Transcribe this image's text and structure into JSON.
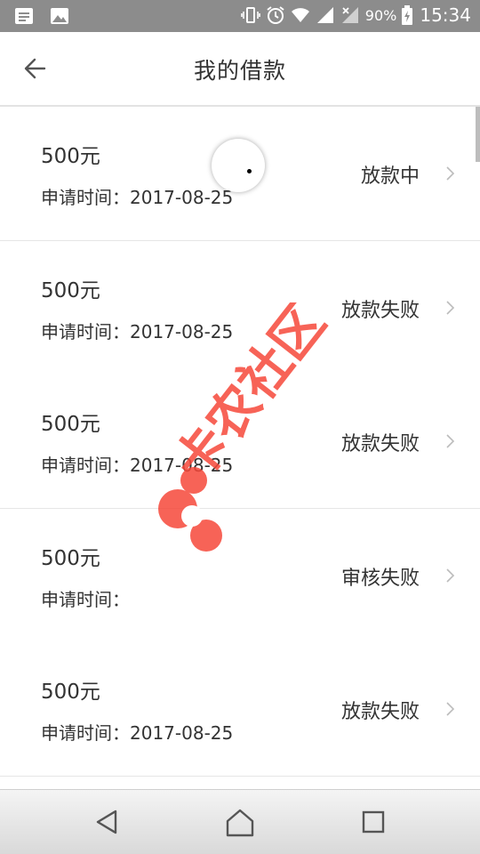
{
  "status_bar": {
    "battery": "90%",
    "time": "15:34",
    "icons": [
      "notification-icon",
      "image-icon",
      "vibrate-icon",
      "alarm-icon",
      "wifi-icon",
      "signal-icon",
      "signal-icon",
      "battery-icon"
    ]
  },
  "header": {
    "title": "我的借款"
  },
  "loans": [
    {
      "amount": "500元",
      "date_label": "申请时间：2017-08-25",
      "status": "放款中"
    },
    {
      "amount": "500元",
      "date_label": "申请时间：2017-08-25",
      "status": "放款失败"
    },
    {
      "amount": "500元",
      "date_label": "申请时间：2017-08-25",
      "status": "放款失败"
    },
    {
      "amount": "500元",
      "date_label": "申请时间：",
      "status": "审核失败"
    },
    {
      "amount": "500元",
      "date_label": "申请时间：2017-08-25",
      "status": "放款失败"
    }
  ],
  "watermark": {
    "text": "卡农社区",
    "color": "#f6483a"
  },
  "colors": {
    "status_bar": "#8c8c8c",
    "text": "#333333",
    "divider": "#e6e6e6"
  }
}
